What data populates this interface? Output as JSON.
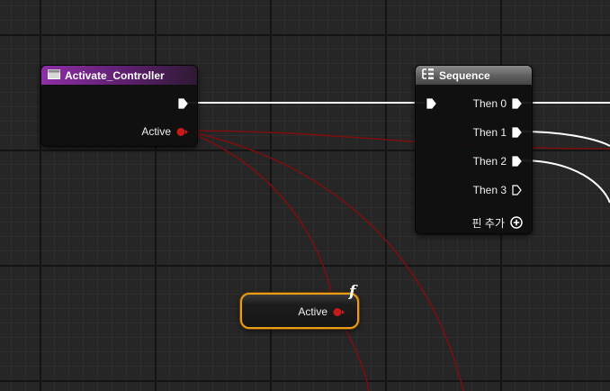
{
  "nodes": {
    "activate_controller": {
      "title": "Activate_Controller",
      "output_active_label": "Active"
    },
    "sequence": {
      "title": "Sequence",
      "outputs": [
        "Then 0",
        "Then 1",
        "Then 2",
        "Then 3"
      ],
      "add_pin_label": "핀 추가"
    },
    "active_variable": {
      "label": "Active",
      "function_glyph": "f"
    }
  },
  "icons": {
    "function_node_icon": "function-icon",
    "sequence_node_icon": "sequence-icon",
    "add_pin_icon": "plus-circle-icon"
  },
  "colors": {
    "function_header": "#8e2fa6",
    "sequence_header": "#6e6e6e",
    "boolean_wire": "#7a0f0f",
    "boolean_pin": "#c81a1a",
    "exec_wire": "#ffffff",
    "variable_selection": "#e89c18"
  }
}
